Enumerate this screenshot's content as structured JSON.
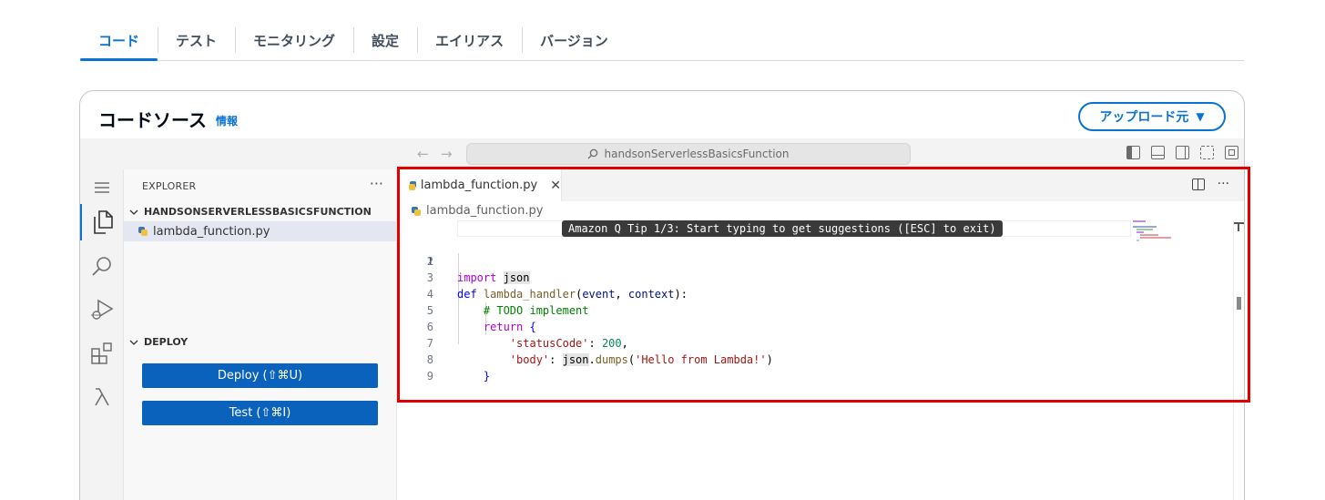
{
  "tabs": [
    {
      "label": "コード",
      "active": true
    },
    {
      "label": "テスト"
    },
    {
      "label": "モニタリング"
    },
    {
      "label": "設定"
    },
    {
      "label": "エイリアス"
    },
    {
      "label": "バージョン"
    }
  ],
  "code_source": {
    "title": "コードソース",
    "info_link": "情報",
    "upload_button": "アップロード元"
  },
  "ide": {
    "command_center": "handsonServerlessBasicsFunction",
    "explorer": {
      "header": "EXPLORER",
      "folder": "HANDSONSERVERLESSBASICSFUNCTION",
      "file": "lambda_function.py",
      "deploy_section": "DEPLOY",
      "deploy_button": "Deploy (⇧⌘U)",
      "test_button": "Test (⇧⌘I)"
    },
    "editor": {
      "tab_label": "lambda_function.py",
      "breadcrumb": "lambda_function.py",
      "tip": "Amazon Q Tip 1/3: Start typing to get suggestions ([ESC] to exit)",
      "line_numbers": [
        "1",
        "2",
        "3",
        "4",
        "5",
        "6",
        "7",
        "8",
        "9"
      ],
      "current_line": 1,
      "code": [
        "import json",
        "",
        "def lambda_handler(event, context):",
        "    # TODO implement",
        "    return {",
        "        'statusCode': 200,",
        "        'body': json.dumps('Hello from Lambda!')",
        "    }",
        ""
      ]
    }
  },
  "colors": {
    "accent": "#0972d3",
    "deploy_button": "#0a62bd",
    "highlight_box": "#e00000"
  },
  "icons": [
    "menu-icon",
    "explorer-icon",
    "search-icon",
    "run-debug-icon",
    "extensions-icon",
    "lambda-icon",
    "python-file-icon",
    "split-editor-icon",
    "more-icon",
    "close-icon",
    "chevron-down-icon"
  ]
}
